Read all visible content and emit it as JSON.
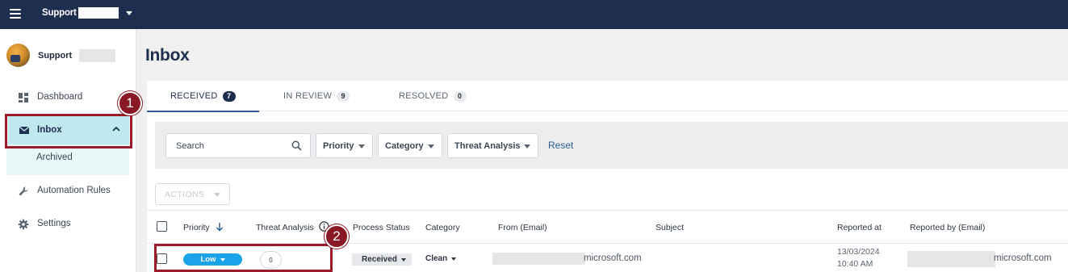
{
  "topbar": {
    "org_name": "Support",
    "menu_icon": "hamburger-menu-icon"
  },
  "sidebar": {
    "user_name": "Support",
    "items": [
      {
        "label": "Dashboard",
        "icon": "dashboard-icon"
      },
      {
        "label": "Inbox",
        "icon": "mail-icon",
        "active": true
      },
      {
        "label": "Archived"
      },
      {
        "label": "Automation Rules",
        "icon": "wrench-icon"
      },
      {
        "label": "Settings",
        "icon": "gear-icon"
      }
    ]
  },
  "page": {
    "title": "Inbox"
  },
  "tabs": [
    {
      "label": "RECEIVED",
      "count": "7"
    },
    {
      "label": "IN REVIEW",
      "count": "9"
    },
    {
      "label": "RESOLVED",
      "count": "0"
    }
  ],
  "filters": {
    "search_placeholder": "Search",
    "priority": "Priority",
    "category": "Category",
    "threat_analysis": "Threat Analysis",
    "reset": "Reset"
  },
  "actions_label": "ACTIONS",
  "table": {
    "headers": {
      "priority": "Priority",
      "threat_analysis": "Threat Analysis",
      "process_status": "Process Status",
      "category": "Category",
      "from": "From (Email)",
      "subject": "Subject",
      "reported_at": "Reported at",
      "reported_by": "Reported by (Email)"
    },
    "rows": [
      {
        "priority": "Low",
        "threat_score": "0",
        "process_status": "Received",
        "category": "Clean",
        "from_tail": "microsoft.com",
        "subject": "",
        "reported_date": "13/03/2024",
        "reported_time": "10:40 AM",
        "reported_by_tail": "microsoft.com"
      }
    ]
  },
  "annotations": {
    "marker_1": "1",
    "marker_2": "2"
  },
  "colors": {
    "topbar": "#1e2e4f",
    "accent_active": "#bfe9ee",
    "highlight": "#9b1b2a",
    "low_pill": "#1aa3e8"
  }
}
